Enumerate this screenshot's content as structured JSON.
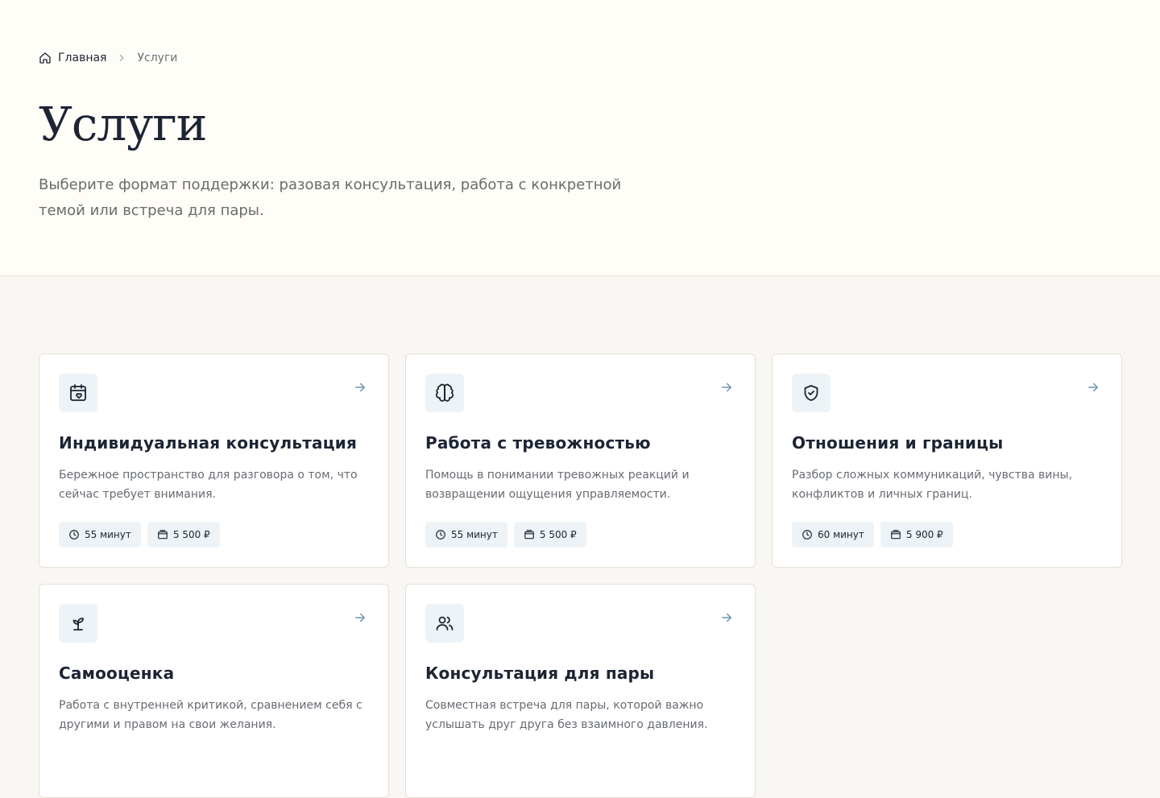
{
  "breadcrumb": {
    "home_label": "Главная",
    "current_label": "Услуги"
  },
  "page": {
    "title": "Услуги",
    "subtitle": "Выберите формат поддержки: разовая консультация, работа с конкретной темой или встреча для пары."
  },
  "colors": {
    "accent": "#6b95ad",
    "icon_bg": "#edf3f6",
    "text": "#1d2433"
  },
  "services": [
    {
      "icon": "calendar-heart-icon",
      "title": "Индивидуальная консультация",
      "description": "Бережное пространство для разговора о том, что сейчас требует внимания.",
      "duration": "55 минут",
      "price": "5 500 ₽"
    },
    {
      "icon": "brain-icon",
      "title": "Работа с тревожностью",
      "description": "Помощь в понимании тревожных реакций и возвращении ощущения управляемости.",
      "duration": "55 минут",
      "price": "5 500 ₽"
    },
    {
      "icon": "shield-check-icon",
      "title": "Отношения и границы",
      "description": "Разбор сложных коммуникаций, чувства вины, конфликтов и личных границ.",
      "duration": "60 минут",
      "price": "5 900 ₽"
    },
    {
      "icon": "sprout-icon",
      "title": "Самооценка",
      "description": "Работа с внутренней критикой, сравнением себя с другими и правом на свои желания.",
      "duration": "",
      "price": ""
    },
    {
      "icon": "users-icon",
      "title": "Консультация для пары",
      "description": "Совместная встреча для пары, которой важно услышать друг друга без взаимного давления.",
      "duration": "",
      "price": ""
    }
  ]
}
